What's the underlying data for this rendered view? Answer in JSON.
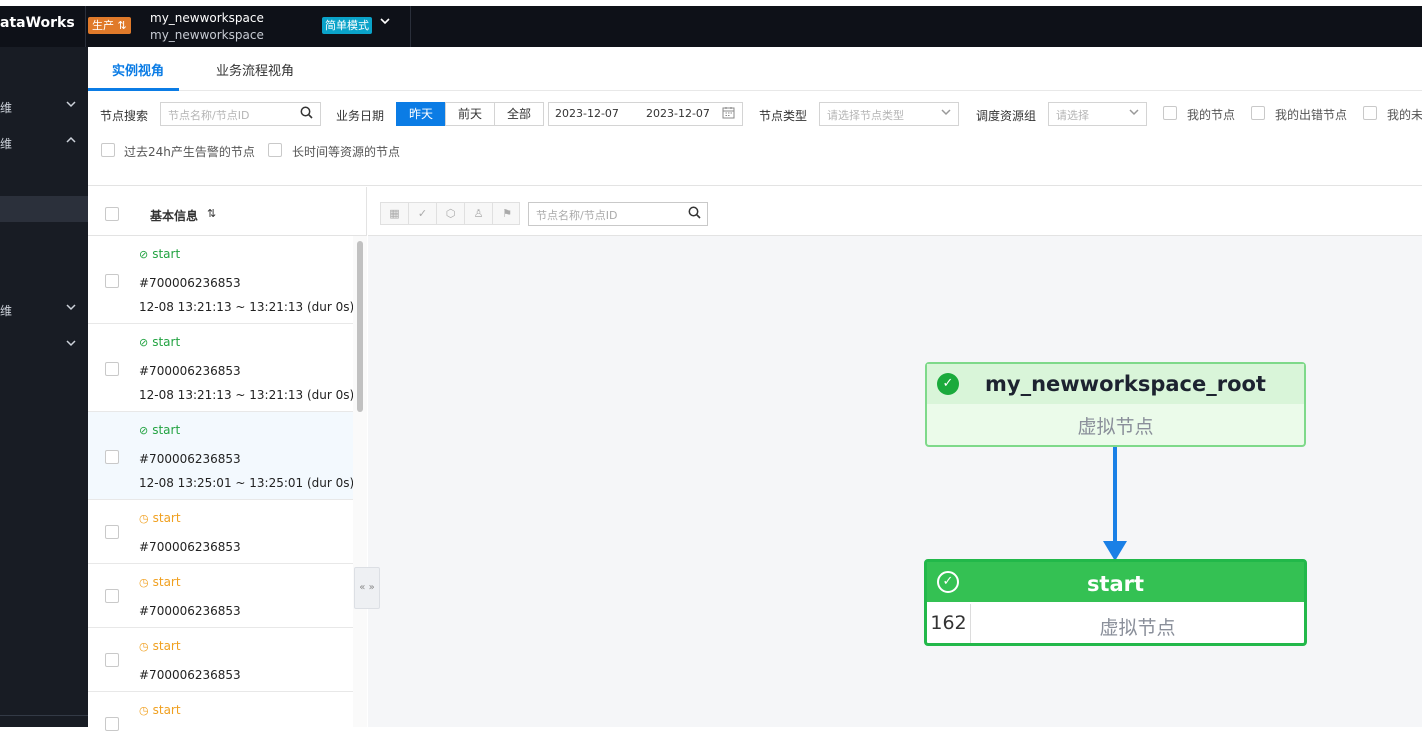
{
  "topbar": {
    "brand": "ataWorks",
    "env_badge": "生产 ⇅",
    "workspace_name": "my_newworkspace",
    "workspace_sub": "my_newworkspace",
    "mode_badge": "简单模式",
    "mode_chevron": "chevron-down-icon"
  },
  "sidebar": {
    "items": [
      {
        "label": "维",
        "chevron": "chevron-down-icon"
      },
      {
        "label": "维",
        "chevron": "chevron-up-icon"
      },
      {
        "label": "维",
        "chevron": "chevron-down-icon"
      },
      {
        "label": "",
        "chevron": "chevron-down-icon"
      }
    ]
  },
  "tabs": [
    {
      "label": "实例视角",
      "active": true
    },
    {
      "label": "业务流程视角",
      "active": false
    }
  ],
  "filters": {
    "node_search_label": "节点搜索",
    "node_search_placeholder": "节点名称/节点ID",
    "biz_date_label": "业务日期",
    "date_buttons": [
      "昨天",
      "前天",
      "全部"
    ],
    "active_date_button": "昨天",
    "date_start": "2023-12-07",
    "date_end": "2023-12-07",
    "node_type_label": "节点类型",
    "node_type_placeholder": "请选择节点类型",
    "resource_group_label": "调度资源组",
    "resource_group_placeholder": "请选择",
    "checkboxes": [
      "我的节点",
      "我的出错节点",
      "我的未"
    ],
    "checkboxes_row2": [
      "过去24h产生告警的节点",
      "长时间等资源的节点"
    ]
  },
  "list": {
    "header": "基本信息",
    "rows": [
      {
        "status": "ok",
        "name": "start",
        "id": "#700006236853",
        "time": "12-08 13:21:13 ~ 13:21:13 (dur 0s)",
        "selected": false
      },
      {
        "status": "ok",
        "name": "start",
        "id": "#700006236853",
        "time": "12-08 13:21:13 ~ 13:21:13 (dur 0s)",
        "selected": false
      },
      {
        "status": "ok",
        "name": "start",
        "id": "#700006236853",
        "time": "12-08 13:25:01 ~ 13:25:01 (dur 0s)",
        "selected": true
      },
      {
        "status": "wait",
        "name": "start",
        "id": "#700006236853",
        "time": "",
        "selected": false
      },
      {
        "status": "wait",
        "name": "start",
        "id": "#700006236853",
        "time": "",
        "selected": false
      },
      {
        "status": "wait",
        "name": "start",
        "id": "#700006236853",
        "time": "",
        "selected": false
      },
      {
        "status": "wait",
        "name": "start",
        "id": "",
        "time": "",
        "selected": false
      }
    ]
  },
  "canvas": {
    "search_placeholder": "节点名称/节点ID",
    "root_node": {
      "name": "my_newworkspace_root",
      "type": "虚拟节点"
    },
    "start_node": {
      "name": "start",
      "count": "162",
      "type": "虚拟节点"
    }
  },
  "colors": {
    "accent": "#0b7ce5",
    "success": "#23a342",
    "waiting": "#f0a020",
    "env_badge": "#e07a2a",
    "mode_badge": "#0aa3c9"
  }
}
